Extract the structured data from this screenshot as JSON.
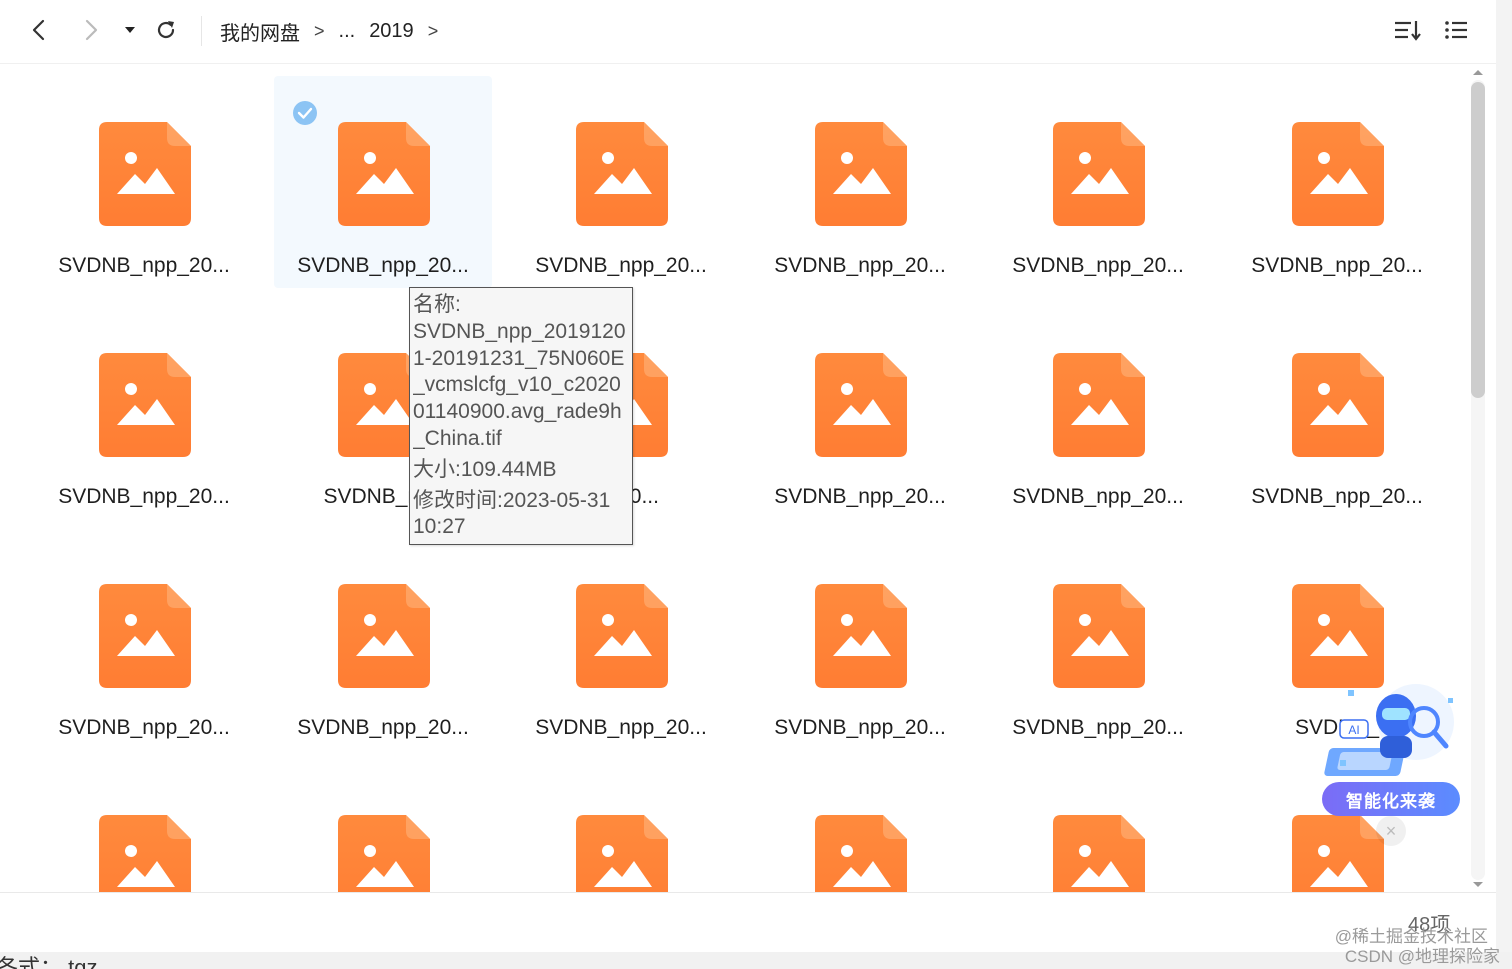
{
  "toolbar": {
    "icons": [
      "back-arrow-icon",
      "forward-arrow-icon",
      "dropdown-caret-icon",
      "refresh-icon",
      "sort-icon",
      "list-view-icon"
    ]
  },
  "breadcrumb": {
    "root": "我的网盘",
    "ellipsis": "...",
    "current": "2019",
    "separator": ">"
  },
  "files": {
    "truncated_name": "SVDNB_npp_20...",
    "rows": [
      [
        "SVDNB_npp_20...",
        "SVDNB_npp_20...",
        "SVDNB_npp_20...",
        "SVDNB_npp_20...",
        "SVDNB_npp_20...",
        "SVDNB_npp_20..."
      ],
      [
        "SVDNB_npp_20...",
        "SVDNB_npp",
        "pp_20...",
        "SVDNB_npp_20...",
        "SVDNB_npp_20...",
        "SVDNB_npp_20..."
      ],
      [
        "SVDNB_npp_20...",
        "SVDNB_npp_20...",
        "SVDNB_npp_20...",
        "SVDNB_npp_20...",
        "SVDNB_npp_20...",
        "SVDNB_"
      ],
      [
        "",
        "",
        "",
        "",
        "",
        ""
      ]
    ],
    "selected_index": 1,
    "icon_color": "#ff7d33"
  },
  "tooltip": {
    "lines": [
      "名称:",
      "SVDNB_npp_2019120",
      "1-20191231_75N060E",
      "_vcmslcfg_v10_c2020",
      "01140900.avg_rade9h",
      "_China.tif",
      "大小:109.44MB",
      "修改时间:2023-05-31",
      "10:27"
    ]
  },
  "ai_widget": {
    "label": "智能化来袭",
    "close": "×"
  },
  "footer": {
    "count": "48项",
    "watermark_1": "@稀土掘金技术社区",
    "watermark_2": "CSDN @地理探险家"
  },
  "bottom_strip": {
    "text": "各式： tgz"
  }
}
